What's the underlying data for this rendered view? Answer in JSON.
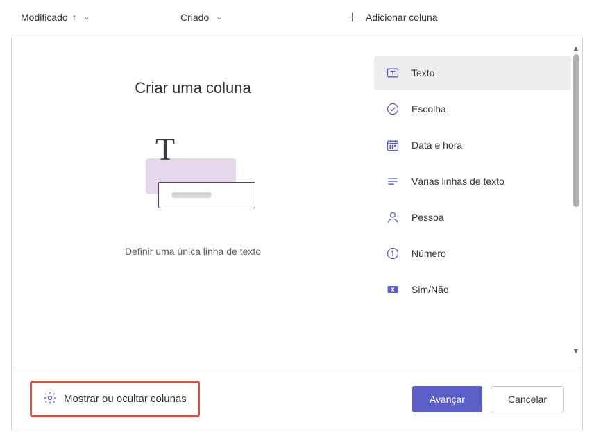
{
  "header": {
    "modified_label": "Modificado",
    "created_label": "Criado",
    "add_column_label": "Adicionar coluna"
  },
  "panel": {
    "title": "Criar uma coluna",
    "subtitle": "Definir uma única linha de texto"
  },
  "column_types": [
    {
      "id": "text",
      "label": "Texto",
      "selected": true
    },
    {
      "id": "choice",
      "label": "Escolha",
      "selected": false
    },
    {
      "id": "datetime",
      "label": "Data e hora",
      "selected": false
    },
    {
      "id": "multiline",
      "label": "Várias linhas de texto",
      "selected": false
    },
    {
      "id": "person",
      "label": "Pessoa",
      "selected": false
    },
    {
      "id": "number",
      "label": "Número",
      "selected": false
    },
    {
      "id": "yesno",
      "label": "Sim/Não",
      "selected": false
    }
  ],
  "footer": {
    "show_hide_label": "Mostrar ou ocultar colunas",
    "next_label": "Avançar",
    "cancel_label": "Cancelar"
  },
  "colors": {
    "accent": "#5b5fc7",
    "highlight_border": "#e24a3a"
  }
}
